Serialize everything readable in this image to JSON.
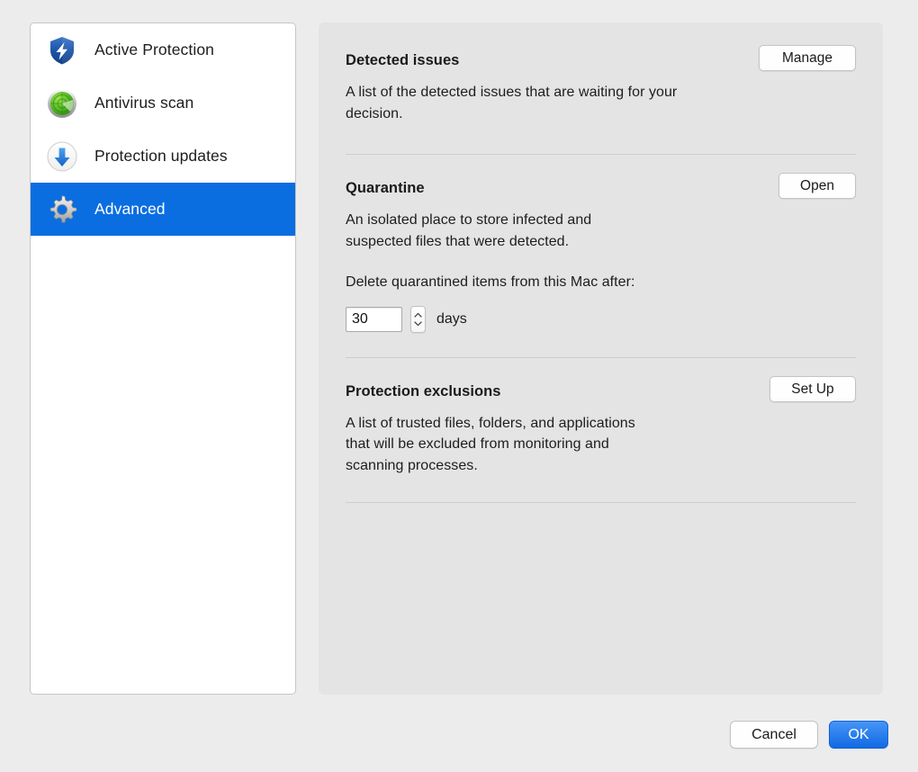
{
  "sidebar": {
    "items": [
      {
        "label": "Active Protection",
        "icon": "shield-bolt-icon",
        "selected": false
      },
      {
        "label": "Antivirus scan",
        "icon": "radar-scan-icon",
        "selected": false
      },
      {
        "label": "Protection updates",
        "icon": "download-arrow-icon",
        "selected": false
      },
      {
        "label": "Advanced",
        "icon": "gear-icon",
        "selected": true
      }
    ]
  },
  "main": {
    "sections": [
      {
        "title": "Detected issues",
        "description": "A list of the detected issues that are waiting for your decision.",
        "button": "Manage"
      },
      {
        "title": "Quarantine",
        "description": "An isolated place to store infected and suspected files that were detected.",
        "button": "Open",
        "setting_label": "Delete quarantined items from this Mac after:",
        "setting_value": "30",
        "setting_unit": "days"
      },
      {
        "title": "Protection exclusions",
        "description": "A list of trusted files, folders, and applications that will be excluded from monitoring and scanning processes.",
        "button": "Set Up"
      }
    ]
  },
  "footer": {
    "cancel_label": "Cancel",
    "ok_label": "OK"
  },
  "colors": {
    "accent": "#0a6ee1",
    "window_background": "#ececec",
    "panel_background": "#e4e4e4",
    "sidebar_background": "#ffffff"
  }
}
